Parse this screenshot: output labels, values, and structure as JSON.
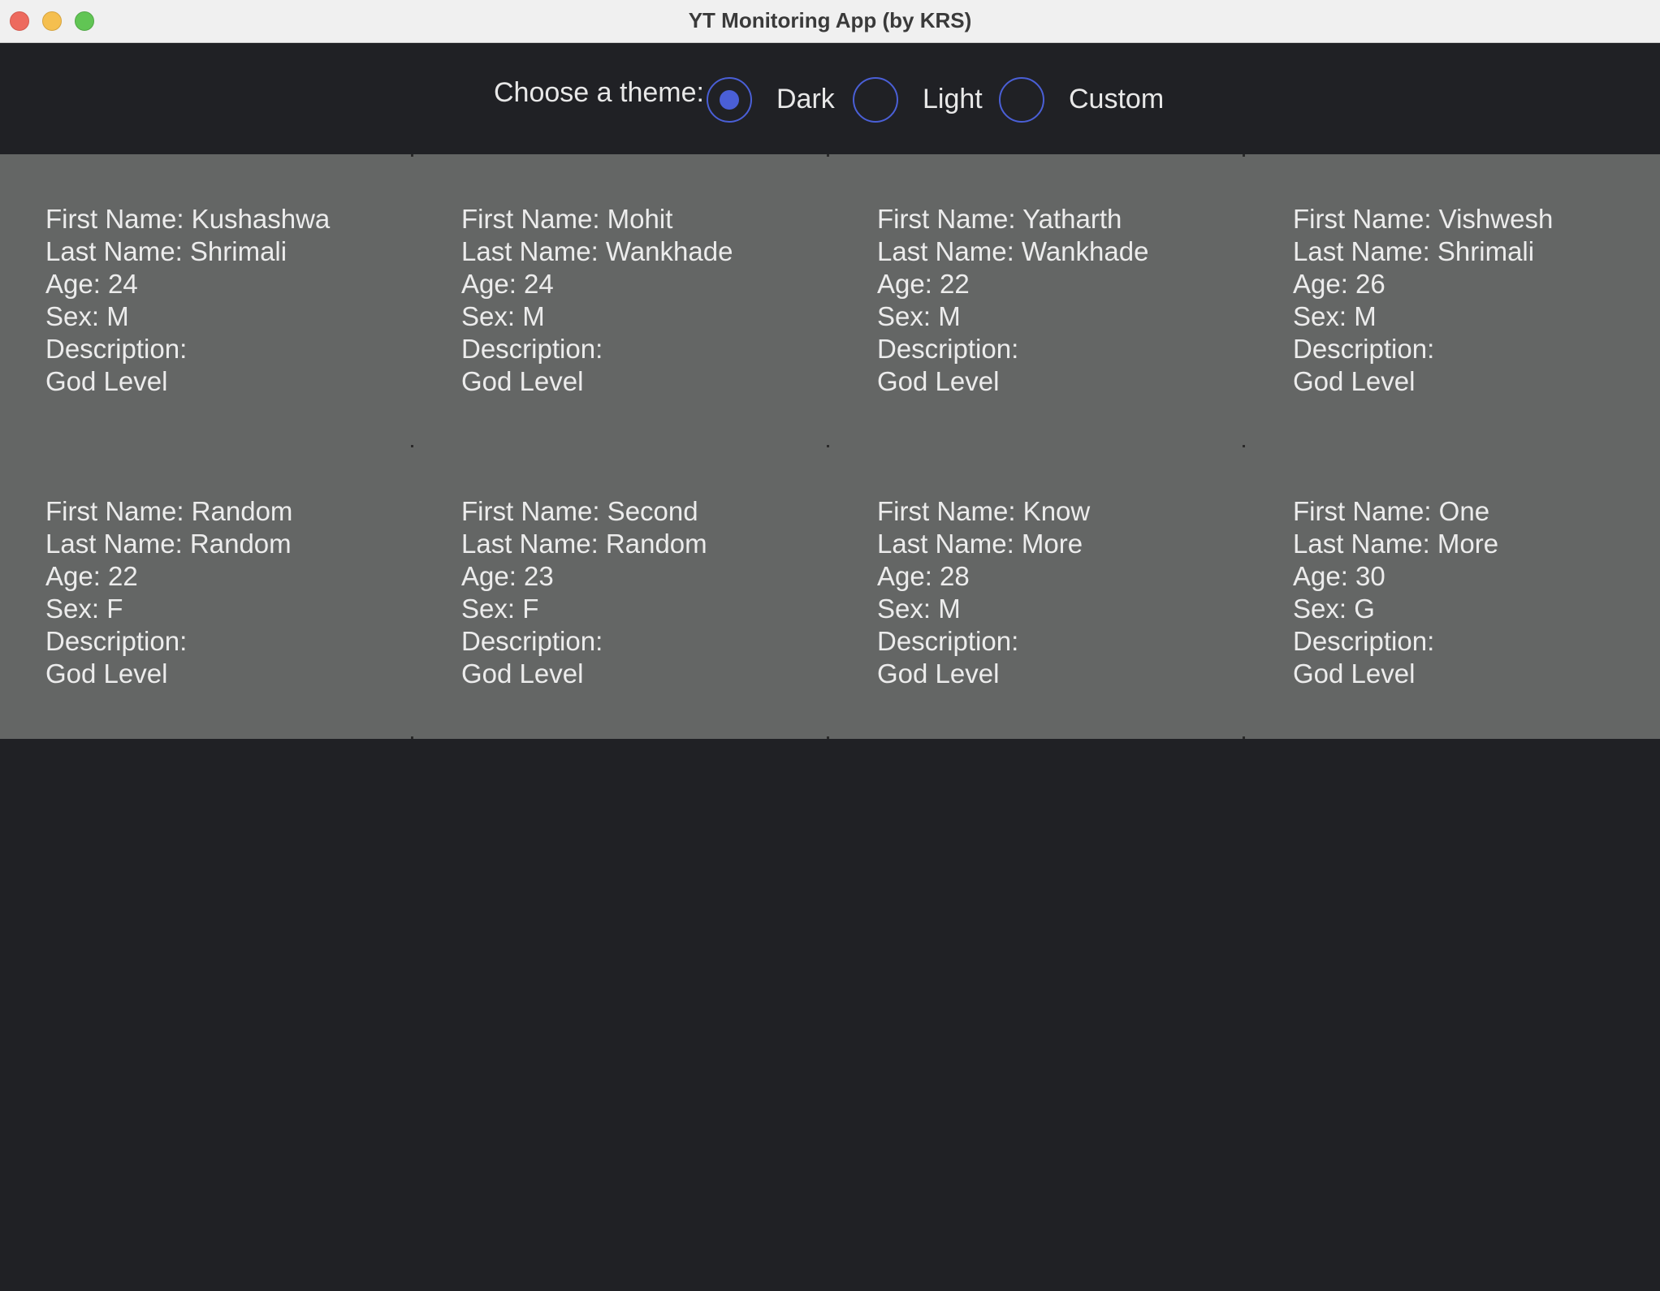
{
  "window": {
    "title": "YT Monitoring App (by KRS)"
  },
  "theme": {
    "label": "Choose a theme:",
    "options": [
      {
        "label": "Dark",
        "selected": true
      },
      {
        "label": "Light",
        "selected": false
      },
      {
        "label": "Custom",
        "selected": false
      }
    ],
    "accent_color": "#4a5fd6"
  },
  "people": [
    {
      "first": "First Name: Kushashwa",
      "last": "Last Name: Shrimali",
      "age": "Age: 24",
      "sex": "Sex: M",
      "desc_label": "Description:",
      "desc": "God Level"
    },
    {
      "first": "First Name: Mohit",
      "last": "Last Name: Wankhade",
      "age": "Age: 24",
      "sex": "Sex: M",
      "desc_label": "Description:",
      "desc": "God Level"
    },
    {
      "first": "First Name: Yatharth",
      "last": "Last Name: Wankhade",
      "age": "Age: 22",
      "sex": "Sex: M",
      "desc_label": "Description:",
      "desc": "God Level"
    },
    {
      "first": "First Name: Vishwesh",
      "last": "Last Name: Shrimali",
      "age": "Age: 26",
      "sex": "Sex: M",
      "desc_label": "Description:",
      "desc": "God Level"
    },
    {
      "first": "First Name: Random",
      "last": "Last Name: Random",
      "age": "Age: 22",
      "sex": "Sex: F",
      "desc_label": "Description:",
      "desc": "God Level"
    },
    {
      "first": "First Name: Second",
      "last": "Last Name: Random",
      "age": "Age: 23",
      "sex": "Sex: F",
      "desc_label": "Description:",
      "desc": "God Level"
    },
    {
      "first": "First Name: Know",
      "last": "Last Name: More",
      "age": "Age: 28",
      "sex": "Sex: M",
      "desc_label": "Description:",
      "desc": "God Level"
    },
    {
      "first": "First Name: One",
      "last": "Last Name: More",
      "age": "Age: 30",
      "sex": "Sex: G",
      "desc_label": "Description:",
      "desc": "God Level"
    }
  ]
}
